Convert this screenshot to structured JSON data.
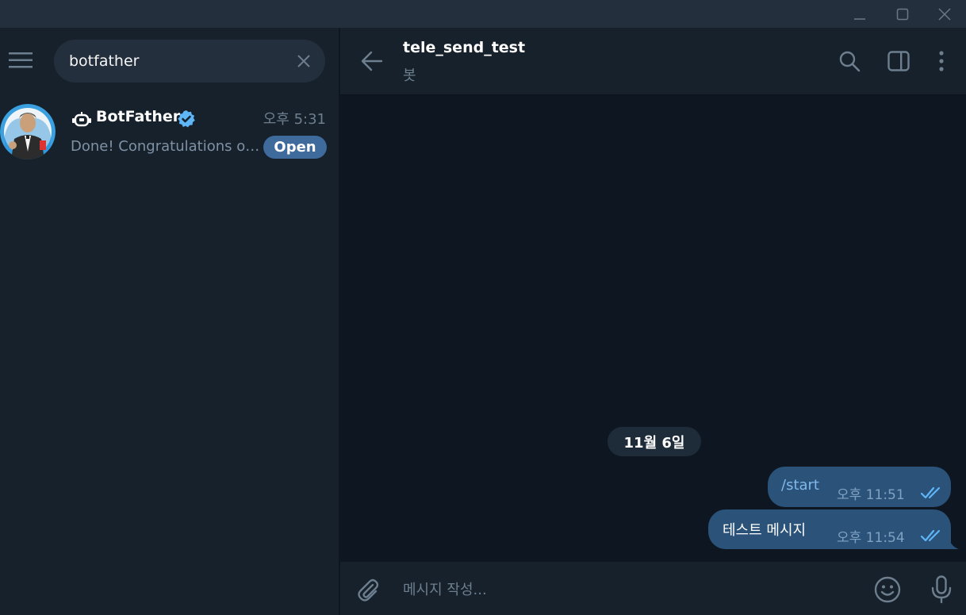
{
  "window": {
    "controls": [
      "minimize-icon",
      "maximize-icon",
      "close-icon"
    ]
  },
  "sidebar": {
    "search": {
      "value": "botfather",
      "placeholder": ""
    },
    "results": [
      {
        "name": "BotFather",
        "time": "오후 5:31",
        "preview": "Done! Congratulations on your new bot.",
        "badge": "Open",
        "verified": true,
        "is_bot": true
      }
    ]
  },
  "chat": {
    "title": "tele_send_test",
    "subtitle": "봇",
    "date_separator": "11월 6일",
    "messages": [
      {
        "text": "/start",
        "time": "오후 11:51",
        "status": "read"
      },
      {
        "text": "테스트 메시지",
        "time": "오후 11:54",
        "status": "read"
      }
    ],
    "composer": {
      "placeholder": "메시지 작성..."
    }
  },
  "colors": {
    "accent": "#5eb5f7",
    "outgoing_bubble": "#2b5278",
    "panel": "#17212b",
    "chat_bg": "#0e1621",
    "badge": "#3e6a9c"
  }
}
